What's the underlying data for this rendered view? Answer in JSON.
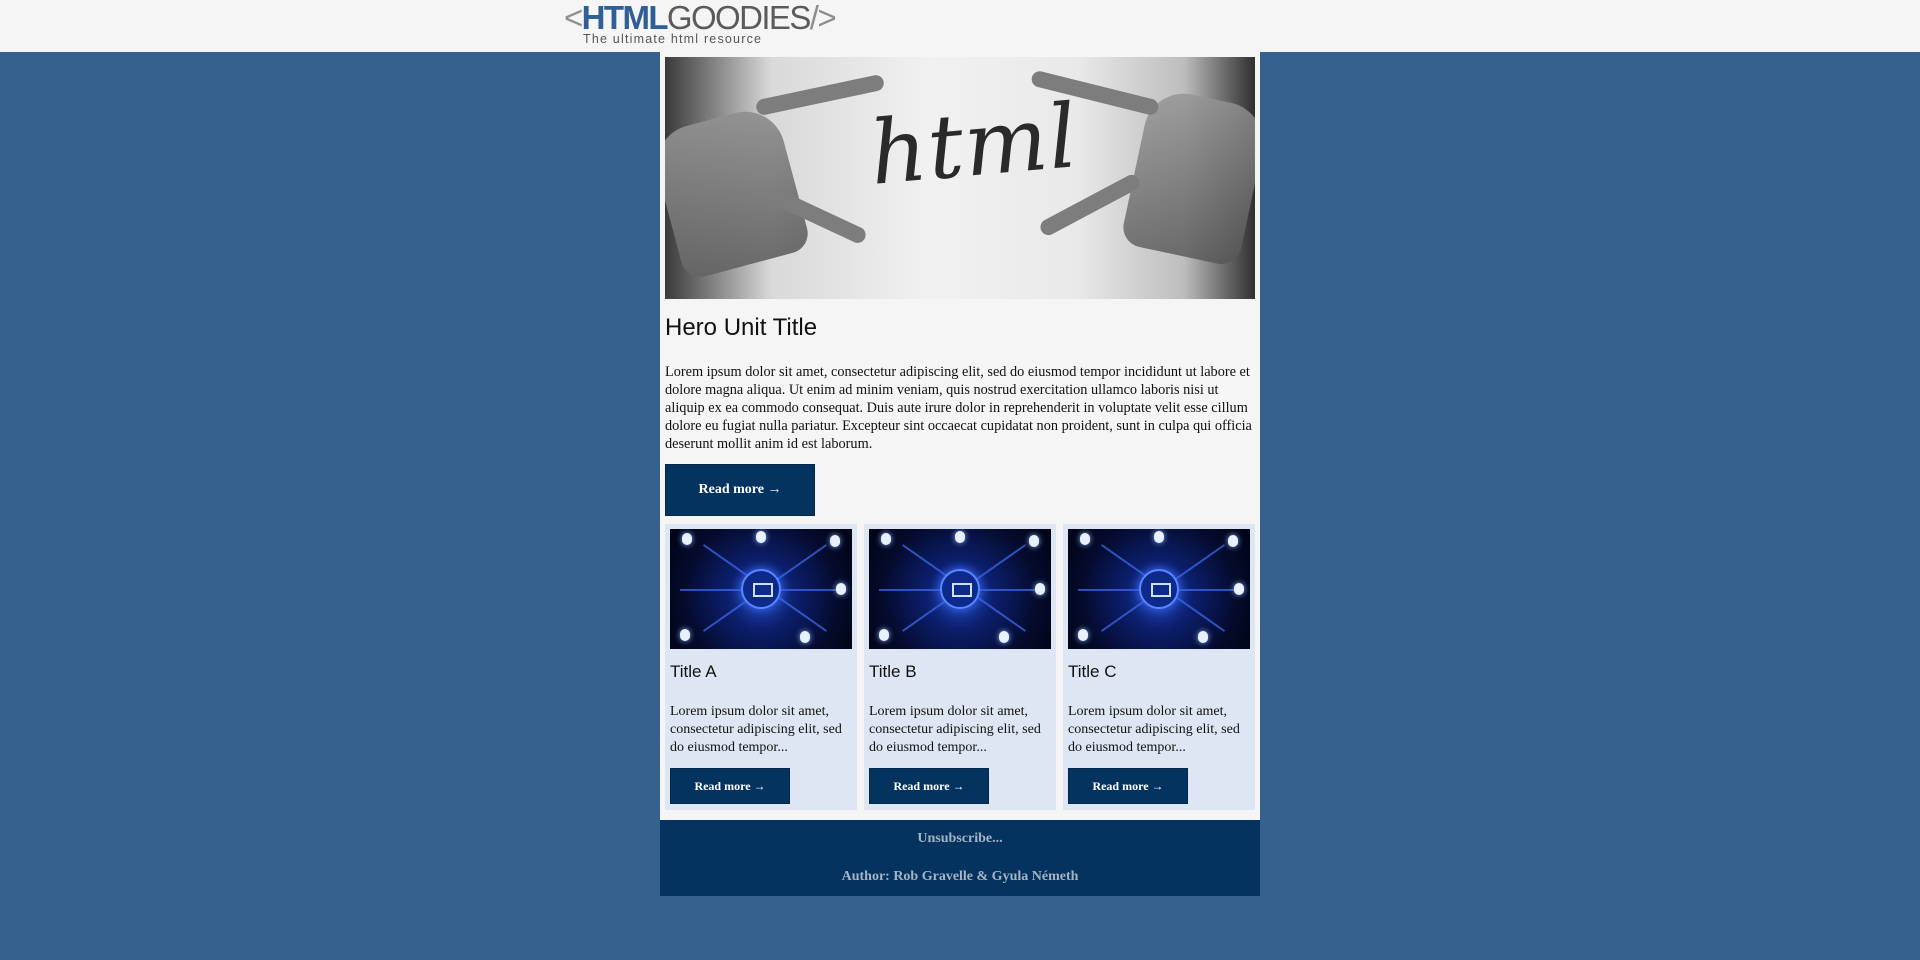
{
  "header": {
    "logo": {
      "bracket_open": "<",
      "brand_html": "HTML",
      "brand_goodies": "GOODIES",
      "bracket_close": "/>",
      "tagline": "The ultimate html resource"
    }
  },
  "hero": {
    "image_icon": "hands-pointing-at-html-shirt-photo",
    "shirt_text": "html",
    "title": "Hero Unit Title",
    "body": "Lorem ipsum dolor sit amet, consectetur adipiscing elit, sed do eiusmod tempor incididunt ut labore et dolore magna aliqua. Ut enim ad minim veniam, quis nostrud exercitation ullamco laboris nisi ut aliquip ex ea commodo consequat. Duis aute irure dolor in reprehenderit in voluptate velit esse cillum dolore eu fugiat nulla pariatur. Excepteur sint occaecat cupidatat non proident, sunt in culpa qui officia deserunt mollit anim id est laborum.",
    "button_label": "Read more →"
  },
  "cards": [
    {
      "image_icon": "email-network-photo",
      "title": "Title A",
      "body": "Lorem ipsum dolor sit amet, consectetur adipiscing elit, sed do eiusmod tempor...",
      "button_label": "Read more →"
    },
    {
      "image_icon": "email-network-photo",
      "title": "Title B",
      "body": "Lorem ipsum dolor sit amet, consectetur adipiscing elit, sed do eiusmod tempor...",
      "button_label": "Read more →"
    },
    {
      "image_icon": "email-network-photo",
      "title": "Title C",
      "body": "Lorem ipsum dolor sit amet, consectetur adipiscing elit, sed do eiusmod tempor...",
      "button_label": "Read more →"
    }
  ],
  "footer": {
    "unsubscribe": "Unsubscribe...",
    "author": "Author: Rob Gravelle & Gyula Németh"
  },
  "colors": {
    "page_background": "#36608e",
    "email_background": "#f5f5f5",
    "button": "#04335f",
    "card_background": "#dde6f2",
    "footer_background": "#04335f",
    "footer_text": "#a6b3c2",
    "logo_html": "#2f5f94"
  }
}
